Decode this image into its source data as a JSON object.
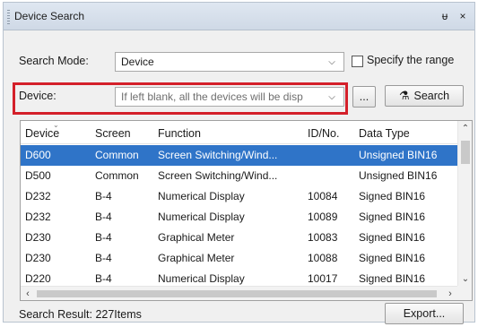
{
  "window": {
    "title": "Device Search",
    "pin_glyph": "ᵾ",
    "close_glyph": "×"
  },
  "search_mode": {
    "label": "Search Mode:",
    "value": "Device",
    "specify_range_label": "Specify the range",
    "specify_range_checked": false
  },
  "device": {
    "label": "Device:",
    "placeholder": "If left blank, all the devices will be disp",
    "browse_label": "...",
    "search_label": "Search",
    "search_icon": "binoculars-icon"
  },
  "grid": {
    "columns": [
      "Device",
      "Screen",
      "Function",
      "ID/No.",
      "Data Type"
    ],
    "rows": [
      {
        "device": "D600",
        "screen": "Common",
        "function": "Screen Switching/Wind...",
        "id": "",
        "type": "Unsigned BIN16",
        "selected": true
      },
      {
        "device": "D500",
        "screen": "Common",
        "function": "Screen Switching/Wind...",
        "id": "",
        "type": "Unsigned BIN16",
        "selected": false
      },
      {
        "device": "D232",
        "screen": "B-4",
        "function": "Numerical Display",
        "id": "10084",
        "type": "Signed BIN16",
        "selected": false
      },
      {
        "device": "D232",
        "screen": "B-4",
        "function": "Numerical Display",
        "id": "10089",
        "type": "Signed BIN16",
        "selected": false
      },
      {
        "device": "D230",
        "screen": "B-4",
        "function": "Graphical Meter",
        "id": "10083",
        "type": "Signed BIN16",
        "selected": false
      },
      {
        "device": "D230",
        "screen": "B-4",
        "function": "Graphical Meter",
        "id": "10088",
        "type": "Signed BIN16",
        "selected": false
      },
      {
        "device": "D220",
        "screen": "B-4",
        "function": "Numerical Display",
        "id": "10017",
        "type": "Signed BIN16",
        "selected": false
      }
    ]
  },
  "footer": {
    "result_text": "Search Result: 227Items",
    "export_label": "Export..."
  },
  "colors": {
    "selection": "#2f74c8",
    "highlight_border": "#d4202a"
  }
}
